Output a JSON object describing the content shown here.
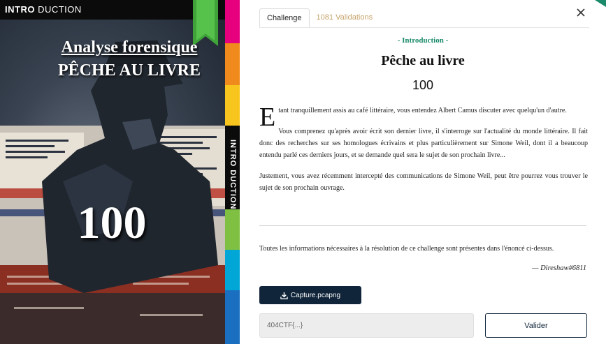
{
  "cover": {
    "brand_bold": "INTRO",
    "brand_light": " DUCTION",
    "category": "Analyse forensique",
    "title": "PÊCHE AU LIVRE",
    "score": "100"
  },
  "spine": {
    "text": "INTRO DUCTION"
  },
  "colors": {
    "accent_green": "#1a8a6a",
    "button_dark": "#10253a",
    "tab_inactive": "#c7a36a"
  },
  "tabs": [
    {
      "label": "Challenge",
      "active": true
    },
    {
      "label": "1081 Validations",
      "active": false
    }
  ],
  "challenge": {
    "category_label": "- Introduction -",
    "title": "Pêche au livre",
    "points": "100",
    "dropcap": "E",
    "para1_rest": "tant tranquillement assis au café littéraire, vous entendez Albert Camus discuter avec quelqu'un d'autre.",
    "para2": "Vous comprenez qu'après avoir écrit son dernier livre, il s'interroge sur l'actualité du monde littéraire. Il fait donc des recherches sur ses homologues écrivains et plus particulièrement sur Simone Weil, dont il a beaucoup entendu parlé ces derniers jours, et se demande quel sera le sujet de son prochain livre...",
    "para3": "Justement, vous avez récemment intercepté des communications de Simone Weil, peut être pourrez vous trouver le sujet de son prochain ouvrage.",
    "info": "Toutes les informations nécessaires à la résolution de ce challenge sont présentes dans l'énoncé ci-dessus.",
    "author": "— Direshaw#6811"
  },
  "actions": {
    "download_label": "Capture.pcapng",
    "flag_placeholder": "404CTF{...}",
    "submit_label": "Valider"
  },
  "icons": {
    "close": "close-icon",
    "download": "download-icon"
  }
}
